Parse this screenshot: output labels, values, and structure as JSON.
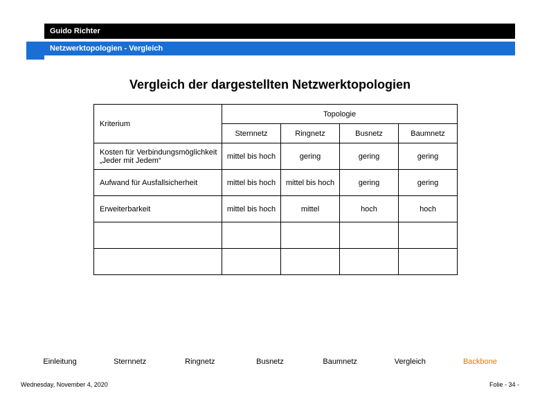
{
  "header": {
    "author": "Guido Richter",
    "subtitle": "Netzwerktopologien  - Vergleich"
  },
  "title": "Vergleich der dargestellten Netzwerktopologien",
  "table": {
    "criterion_label": "Kriterium",
    "topology_label": "Topologie",
    "columns": [
      "Sternnetz",
      "Ringnetz",
      "Busnetz",
      "Baumnetz"
    ],
    "rows": [
      {
        "criterion": "Kosten für Verbindungsmöglichkeit „Jeder mit Jedem“",
        "values": [
          "mittel bis hoch",
          "gering",
          "gering",
          "gering"
        ]
      },
      {
        "criterion": "Aufwand für Ausfallsicherheit",
        "values": [
          "mittel bis hoch",
          "mittel bis hoch",
          "gering",
          "gering"
        ]
      },
      {
        "criterion": "Erweiterbarkeit",
        "values": [
          "mittel bis hoch",
          "mittel",
          "hoch",
          "hoch"
        ]
      }
    ]
  },
  "nav": {
    "items": [
      "Einleitung",
      "Sternnetz",
      "Ringnetz",
      "Busnetz",
      "Baumnetz",
      "Vergleich",
      "Backbone"
    ]
  },
  "footer": {
    "date": "Wednesday, November 4, 2020",
    "page": "Folie - 34 -"
  }
}
